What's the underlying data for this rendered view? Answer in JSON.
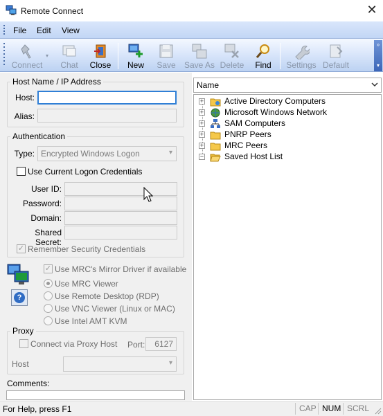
{
  "window": {
    "title": "Remote Connect"
  },
  "menu": {
    "items": [
      "File",
      "Edit",
      "View"
    ]
  },
  "toolbar": {
    "connect": "Connect",
    "chat": "Chat",
    "close": "Close",
    "new": "New",
    "save": "Save",
    "save_as": "Save As",
    "delete": "Delete",
    "find": "Find",
    "settings": "Settings",
    "default": "Default"
  },
  "host_group": {
    "title": "Host Name / IP Address",
    "host_label": "Host:",
    "host_value": "",
    "alias_label": "Alias:",
    "alias_value": ""
  },
  "auth": {
    "title": "Authentication",
    "type_label": "Type:",
    "type_value": "Encrypted Windows Logon",
    "use_current": "Use Current Logon Credentials",
    "user_id_label": "User ID:",
    "password_label": "Password:",
    "domain_label": "Domain:",
    "shared_secret_label": "Shared Secret:",
    "remember": "Remember Security Credentials"
  },
  "viewer": {
    "mirror_driver": "Use MRC's Mirror Driver if available",
    "options": [
      "Use MRC Viewer",
      "Use Remote Desktop (RDP)",
      "Use VNC Viewer (Linux or MAC)",
      "Use Intel AMT KVM"
    ],
    "selected": "Use MRC Viewer"
  },
  "proxy": {
    "title": "Proxy",
    "connect_via": "Connect via Proxy Host",
    "port_label": "Port:",
    "port_value": "6127",
    "host_label": "Host"
  },
  "comments": {
    "label": "Comments:"
  },
  "tree": {
    "column_select": "Name",
    "items": [
      "Active Directory Computers",
      "Microsoft Windows Network",
      "SAM Computers",
      "PNRP Peers",
      "MRC Peers",
      "Saved Host List"
    ]
  },
  "status": {
    "help": "For Help, press F1",
    "cap": "CAP",
    "num": "NUM",
    "scrl": "SCRL"
  }
}
